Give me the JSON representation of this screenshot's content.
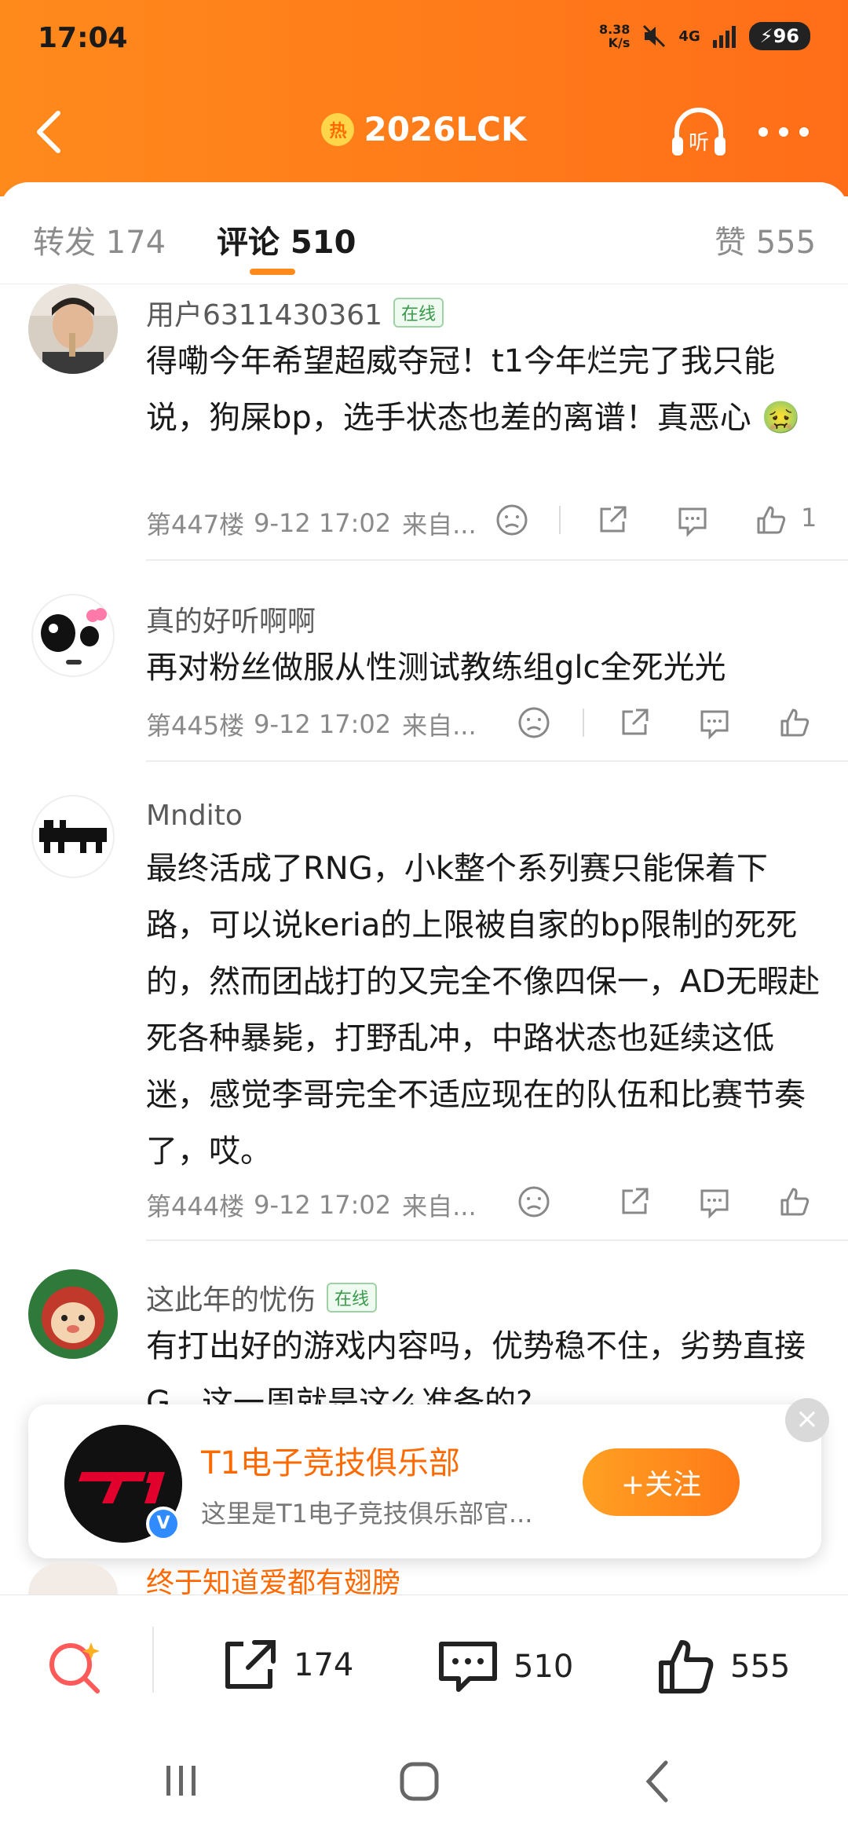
{
  "status_bar": {
    "time": "17:04",
    "net_speed_top": "8.38",
    "net_speed_bottom": "K/s",
    "network": "4G",
    "battery": "96"
  },
  "nav": {
    "hot_badge": "热",
    "title": "2026LCK",
    "listen_label": "听"
  },
  "tabs": {
    "repost": "转发 174",
    "comments": "评论 510",
    "likes": "赞 555"
  },
  "comments": [
    {
      "username": "用户6311430361",
      "badge": "在线",
      "text": "得嘞今年希望超威夺冠！t1今年烂完了我只能说，狗屎bp，选手状态也差的离谱！真恶心",
      "emoji": "🤢",
      "floor": "第447楼",
      "time": "9-12 17:02",
      "source": "来自...",
      "likes": "1"
    },
    {
      "username": "真的好听啊啊",
      "badge": "",
      "text": "再对粉丝做服从性测试教练组glc全死光光",
      "floor": "第445楼",
      "time": "9-12 17:02",
      "source": "来自...",
      "likes": ""
    },
    {
      "username": "Mndito",
      "badge": "",
      "text": "最终活成了RNG，小k整个系列赛只能保着下路，可以说keria的上限被自家的bp限制的死死的，然而团战打的又完全不像四保一，AD无暇赴死各种暴毙，打野乱冲，中路状态也延续这低迷，感觉李哥完全不适应现在的队伍和比赛节奏了，哎。",
      "floor": "第444楼",
      "time": "9-12 17:02",
      "source": "来自...",
      "likes": ""
    },
    {
      "username": "这此年的忧伤",
      "badge": "在线",
      "text": "有打出好的游戏内容吗，优势稳不住，劣势直接G，这一周就是这么准备的?",
      "floor": "",
      "time": "",
      "source": "",
      "likes": ""
    }
  ],
  "follow_card": {
    "name": "T1电子竞技俱乐部",
    "desc": "这里是T1电子竞技俱乐部官...",
    "button": "+关注",
    "close": "×"
  },
  "peek_comment": {
    "username": "终于知道爱都有翅膀_"
  },
  "bottom_bar": {
    "repost_count": "174",
    "comment_count": "510",
    "like_count": "555"
  },
  "colors": {
    "brand_orange": "#ff7b1a",
    "online_green": "#3a9a4c",
    "link_orange": "#ff6a00"
  }
}
